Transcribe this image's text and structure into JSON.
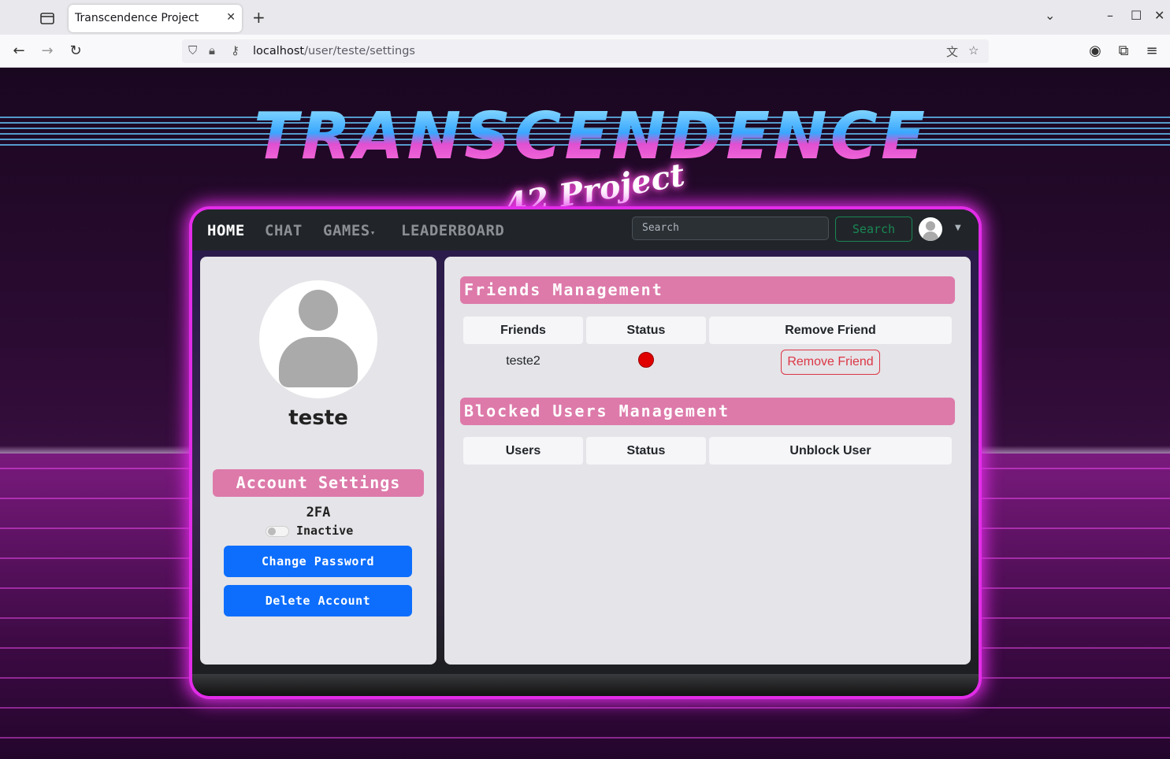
{
  "browser": {
    "tab_title": "Transcendence Project",
    "url_host": "localhost",
    "url_path": "/user/teste/settings"
  },
  "logo": {
    "main": "TRANSCENDENCE",
    "sub": "42 Project"
  },
  "nav": {
    "links": [
      "HOME",
      "CHAT",
      "GAMES",
      "LEADERBOARD"
    ],
    "search_placeholder": "Search",
    "search_button": "Search"
  },
  "profile": {
    "username": "teste",
    "account_settings_title": "Account Settings",
    "twofa_label": "2FA",
    "twofa_status": "Inactive",
    "change_password": "Change Password",
    "delete_account": "Delete Account"
  },
  "friends": {
    "title": "Friends Management",
    "headers": [
      "Friends",
      "Status",
      "Remove Friend"
    ],
    "rows": [
      {
        "name": "teste2",
        "status_color": "#e00000",
        "action": "Remove Friend"
      }
    ]
  },
  "blocked": {
    "title": "Blocked Users Management",
    "headers": [
      "Users",
      "Status",
      "Unblock User"
    ],
    "rows": []
  }
}
